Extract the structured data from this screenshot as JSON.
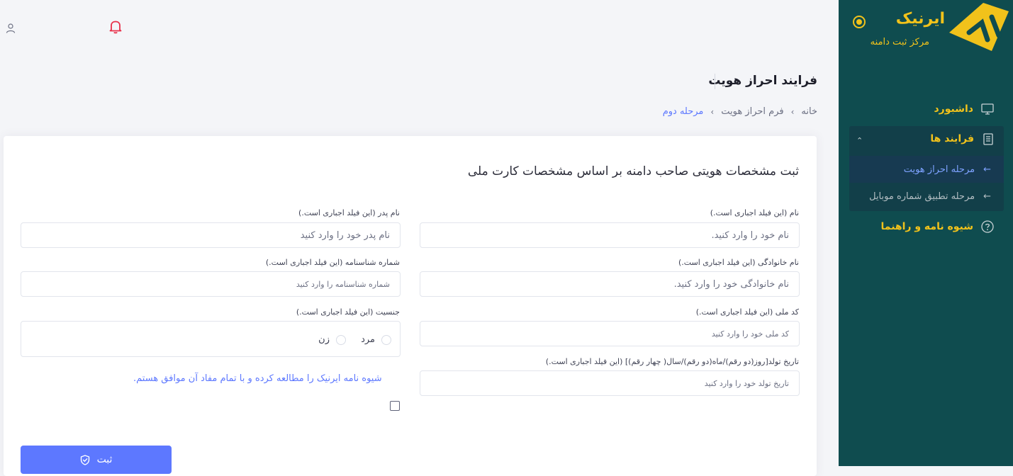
{
  "brand": {
    "name": "ایرنیک",
    "subtitle": "مرکز ثبت دامنه"
  },
  "sidebar": {
    "dashboard": "داشبورد",
    "processes": "فرایند ها",
    "sub_items": [
      "مرحله احراز هویت",
      "مرحله تطبیق شماره موبایل"
    ],
    "guide": "شیوه نامه و راهنما"
  },
  "header": {
    "title": "فرایند احراز هویت"
  },
  "breadcrumb": {
    "items": [
      "خانه",
      "فرم احراز هویت",
      "مرحله دوم"
    ],
    "separator": "›"
  },
  "form": {
    "title": "ثبت مشخصات هویتی صاحب دامنه بر اساس مشخصات کارت ملی",
    "fields": {
      "first_name": {
        "label": "نام (این فیلد اجباری است.)",
        "placeholder": "نام  خود را وارد کنید."
      },
      "father_name": {
        "label": "نام پدر (این فیلد اجباری است.)",
        "placeholder": "نام پدر خود را وارد کنید"
      },
      "last_name": {
        "label": "نام خانوادگی (این فیلد اجباری است.)",
        "placeholder": "نام خانوادگی خود را وارد کنید."
      },
      "id_number": {
        "label": "شماره شناسنامه (این فیلد اجباری است.)",
        "placeholder": "شماره شناسنامه را وارد کنید"
      },
      "national_code": {
        "label": "کد ملی (این فیلد اجباری است.)",
        "placeholder": "کد ملی خود را وارد کنید"
      },
      "gender": {
        "label": "جنسیت (این فیلد اجباری است.)",
        "options": [
          "مرد",
          "زن"
        ]
      },
      "birth_date": {
        "label": "تاریخ تولد[روز(دو رقم)/ماه(دو رقم)/سال( چهار رقم)] (این فیلد اجباری است.)",
        "placeholder": "تاریخ تولد خود را وارد کنید"
      }
    },
    "terms": "شیوه نامه ایرنیک را مطالعه کرده و با تمام مفاد آن موافق هستم.",
    "submit": "ثبت"
  },
  "colors": {
    "sidebar_bg": "#0f4c4f",
    "brand_yellow": "#f1c21b",
    "accent": "#5d78ff",
    "bell": "#e8304a"
  }
}
